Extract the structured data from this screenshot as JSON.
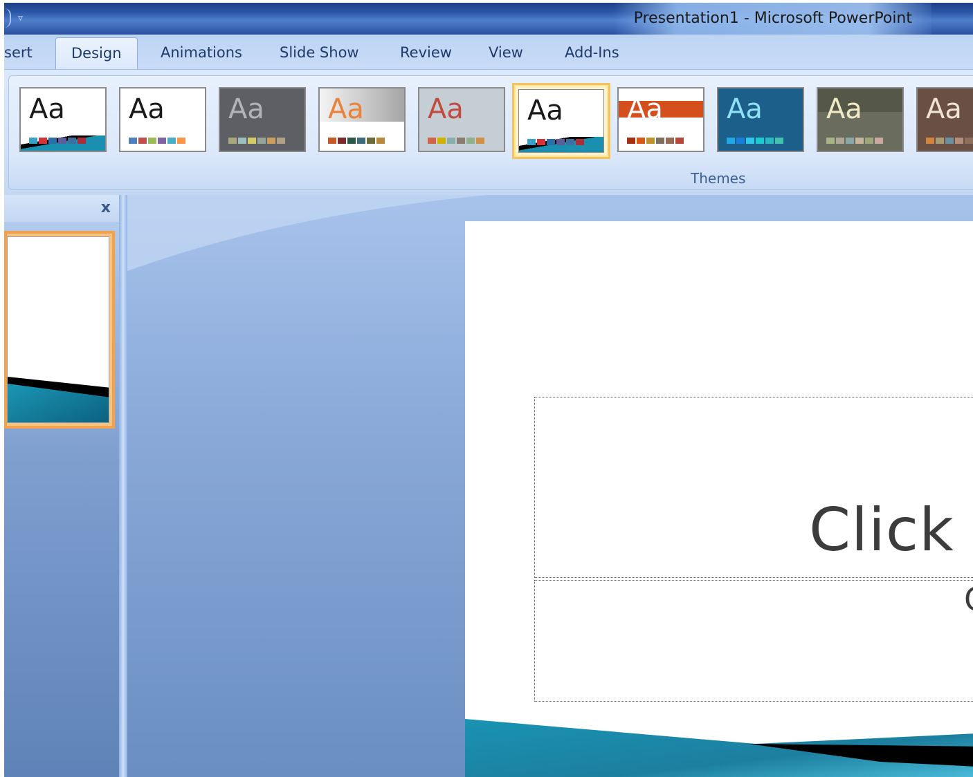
{
  "window": {
    "title": "Presentation1  -  Microsoft PowerPoint",
    "qat_glyph": "▿"
  },
  "tabs": [
    {
      "label": "sert",
      "active": false
    },
    {
      "label": "Design",
      "active": true
    },
    {
      "label": "Animations",
      "active": false
    },
    {
      "label": "Slide Show",
      "active": false
    },
    {
      "label": "Review",
      "active": false
    },
    {
      "label": "View",
      "active": false
    },
    {
      "label": "Add-Ins",
      "active": false
    }
  ],
  "ribbon": {
    "group_label": "Themes",
    "themes": [
      {
        "label": "Aa",
        "bg": "#ffffff",
        "fg": "#1a1a1a",
        "swatches": [
          "#3aa0c6",
          "#d2343a",
          "#2c6fa8",
          "#5d5d9b",
          "#3b70a0",
          "#aa2d3c"
        ]
      },
      {
        "label": "Aa",
        "bg": "#ffffff",
        "fg": "#1a1a1a",
        "swatches": [
          "#4f81bd",
          "#c0504d",
          "#9bbb59",
          "#8064a2",
          "#4bacc6",
          "#f79646"
        ]
      },
      {
        "label": "Aa",
        "bg": "#5e5f64",
        "fg": "#b3b3b8",
        "swatches": [
          "#a9a57c",
          "#9cbebd",
          "#d2cb6c",
          "#95a39d",
          "#c89f5d",
          "#b1a089"
        ]
      },
      {
        "label": "Aa",
        "bg": "#ffffff",
        "fg": "#e9823a",
        "swatches": [
          "#c35a27",
          "#7a2c2a",
          "#2a5a46",
          "#3c6c7a",
          "#6a6a3a",
          "#b8893a"
        ]
      },
      {
        "label": "Aa",
        "bg": "#c5ced4",
        "fg": "#c24b3f",
        "swatches": [
          "#d16349",
          "#ccb400",
          "#8cadae",
          "#8c7b70",
          "#8fb08c",
          "#d19049"
        ]
      },
      {
        "label": "Aa",
        "bg": "#ffffff",
        "fg": "#1a1a1a",
        "swatches": [
          "#3aa0c6",
          "#d2343a",
          "#2c6fa8",
          "#5d5d9b",
          "#3b70a0",
          "#aa2d3c"
        ]
      },
      {
        "label": "Aa",
        "bg": "#ffffff",
        "fg": "#ffffff",
        "swatches": [
          "#a5300f",
          "#d55816",
          "#c0912c",
          "#7e6f5c",
          "#946958",
          "#b4483a"
        ]
      },
      {
        "label": "Aa",
        "bg": "#1c5f8a",
        "fg": "#8fe2f5",
        "swatches": [
          "#1fa7e3",
          "#1a7ed9",
          "#30c8e8",
          "#1ccbd1",
          "#2bb8c0",
          "#45c1b0"
        ]
      },
      {
        "label": "Aa",
        "bg": "#6a6c5e",
        "fg": "#f0e9c7",
        "swatches": [
          "#a8b486",
          "#b0a69a",
          "#8aa8a5",
          "#c7b59b",
          "#9fa87c",
          "#c9a9a1"
        ]
      },
      {
        "label": "Aa",
        "bg": "#6a4f44",
        "fg": "#f0e2d4",
        "swatches": [
          "#d2833e",
          "#a89c74",
          "#6d8f9e",
          "#b38f7a",
          "#8e6e5c",
          "#c9a66b"
        ]
      }
    ]
  },
  "slides_panel": {
    "close_glyph": "x"
  },
  "slide": {
    "title_placeholder": "Click t",
    "subtitle_placeholder": "C"
  }
}
